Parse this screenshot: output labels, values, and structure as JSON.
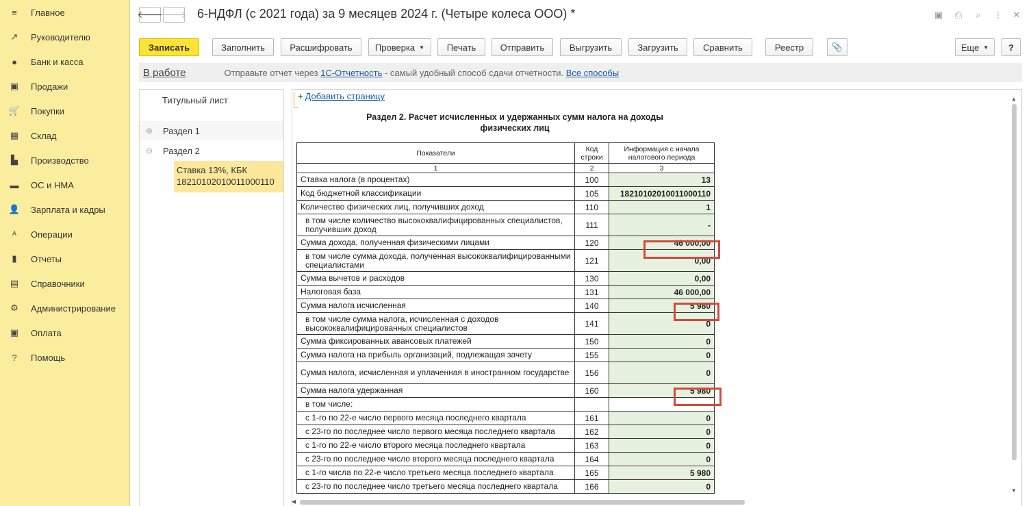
{
  "sidebar": {
    "items": [
      {
        "label": "Главное",
        "icon": "menu-icon",
        "glyph": "≡"
      },
      {
        "label": "Руководителю",
        "icon": "trend-icon",
        "glyph": "↗"
      },
      {
        "label": "Банк и касса",
        "icon": "coin-icon",
        "glyph": "●"
      },
      {
        "label": "Продажи",
        "icon": "bag-icon",
        "glyph": "▣"
      },
      {
        "label": "Покупки",
        "icon": "cart-icon",
        "glyph": "🛒"
      },
      {
        "label": "Склад",
        "icon": "warehouse-icon",
        "glyph": "▦"
      },
      {
        "label": "Производство",
        "icon": "factory-icon",
        "glyph": "▙"
      },
      {
        "label": "ОС и НМА",
        "icon": "truck-icon",
        "glyph": "▬"
      },
      {
        "label": "Зарплата и кадры",
        "icon": "person-icon",
        "glyph": "👤"
      },
      {
        "label": "Операции",
        "icon": "operations-icon",
        "glyph": "ᴬ"
      },
      {
        "label": "Отчеты",
        "icon": "bar-chart-icon",
        "glyph": "▮"
      },
      {
        "label": "Справочники",
        "icon": "books-icon",
        "glyph": "▤"
      },
      {
        "label": "Администрирование",
        "icon": "gear-icon",
        "glyph": "⚙"
      },
      {
        "label": "Оплата",
        "icon": "wallet-icon",
        "glyph": "▣"
      },
      {
        "label": "Помощь",
        "icon": "help-icon",
        "glyph": "?"
      }
    ]
  },
  "window": {
    "title": "6-НДФЛ (с 2021 года) за 9 месяцев 2024 г. (Четыре колеса ООО) *"
  },
  "toolbar": {
    "save": "Записать",
    "fill": "Заполнить",
    "decode": "Расшифровать",
    "check": "Проверка",
    "print": "Печать",
    "send": "Отправить",
    "export": "Выгрузить",
    "import": "Загрузить",
    "compare": "Сравнить",
    "registry": "Реестр",
    "more": "Еще",
    "help": "?"
  },
  "infobar": {
    "status": "В работе",
    "text_before": "Отправьте отчет через ",
    "link1": "1С-Отчетность",
    "text_after": " - самый удобный способ сдачи отчетности. ",
    "link2": "Все способы"
  },
  "tree": {
    "title_page": "Титульный лист",
    "section1": "Раздел 1",
    "section2": "Раздел 2",
    "selected_line1": "Ставка 13%, КБК",
    "selected_line2": "18210102010011000110"
  },
  "report": {
    "add_page": "Добавить страницу",
    "section_title_1": "Раздел 2. Расчет исчисленных и удержанных сумм налога на доходы",
    "section_title_2": "физических лиц",
    "header": {
      "col1": "Показатели",
      "col2_line1": "Код",
      "col2_line2": "строки",
      "col3_line1": "Информация с начала",
      "col3_line2": "налогового периода",
      "n1": "1",
      "n2": "2",
      "n3": "3"
    },
    "rows": [
      {
        "name": "Ставка налога (в процентах)",
        "code": "100",
        "value": "13"
      },
      {
        "name": "Код бюджетной классификации",
        "code": "105",
        "value": "18210102010011000110"
      },
      {
        "name": "Количество физических лиц, получивших доход",
        "code": "110",
        "value": "1"
      },
      {
        "name": "в том числе количество высококвалифицированных специалистов, получивших доход",
        "code": "111",
        "value": "-"
      },
      {
        "name": "Сумма дохода, полученная физическими лицами",
        "code": "120",
        "value": "46 000,00"
      },
      {
        "name": "в том числе сумма дохода, полученная высококвалифицированными специалистами",
        "code": "121",
        "value": "0,00"
      },
      {
        "name": "Сумма вычетов и расходов",
        "code": "130",
        "value": "0,00"
      },
      {
        "name": "Налоговая база",
        "code": "131",
        "value": "46 000,00"
      },
      {
        "name": "Сумма налога исчисленная",
        "code": "140",
        "value": "5 980"
      },
      {
        "name": "в том числе сумма налога, исчисленная с доходов высококвалифицированных специалистов",
        "code": "141",
        "value": "0"
      },
      {
        "name": "Сумма фиксированных авансовых платежей",
        "code": "150",
        "value": "0"
      },
      {
        "name": "Сумма налога на прибыль организаций, подлежащая зачету",
        "code": "155",
        "value": "0"
      },
      {
        "name": "Сумма налога, исчисленная и уплаченная в иностранном государстве",
        "code": "156",
        "value": "0"
      },
      {
        "name": "Сумма налога удержанная",
        "code": "160",
        "value": "5 980"
      },
      {
        "name": "в том числе:",
        "code": "",
        "value": ""
      },
      {
        "name": "с 1-го по 22-е число первого месяца последнего квартала",
        "code": "161",
        "value": "0"
      },
      {
        "name": "с 23-го по последнее число первого месяца последнего квартала",
        "code": "162",
        "value": "0"
      },
      {
        "name": "с 1-го по 22-е число второго месяца последнего квартала",
        "code": "163",
        "value": "0"
      },
      {
        "name": "с 23-го по последнее число второго месяца последнего квартала",
        "code": "164",
        "value": "0"
      },
      {
        "name": "с 1-го числа по 22-е число третьего месяца последнего квартала",
        "code": "165",
        "value": "5 980"
      },
      {
        "name": "с 23-го по последнее число третьего месяца последнего квартала",
        "code": "166",
        "value": "0"
      }
    ]
  },
  "colors": {
    "sidebar_bg": "#fbed9e",
    "primary_button": "#fde335",
    "highlight": "#d04b3b",
    "cell_fill": "#e7f1df"
  }
}
